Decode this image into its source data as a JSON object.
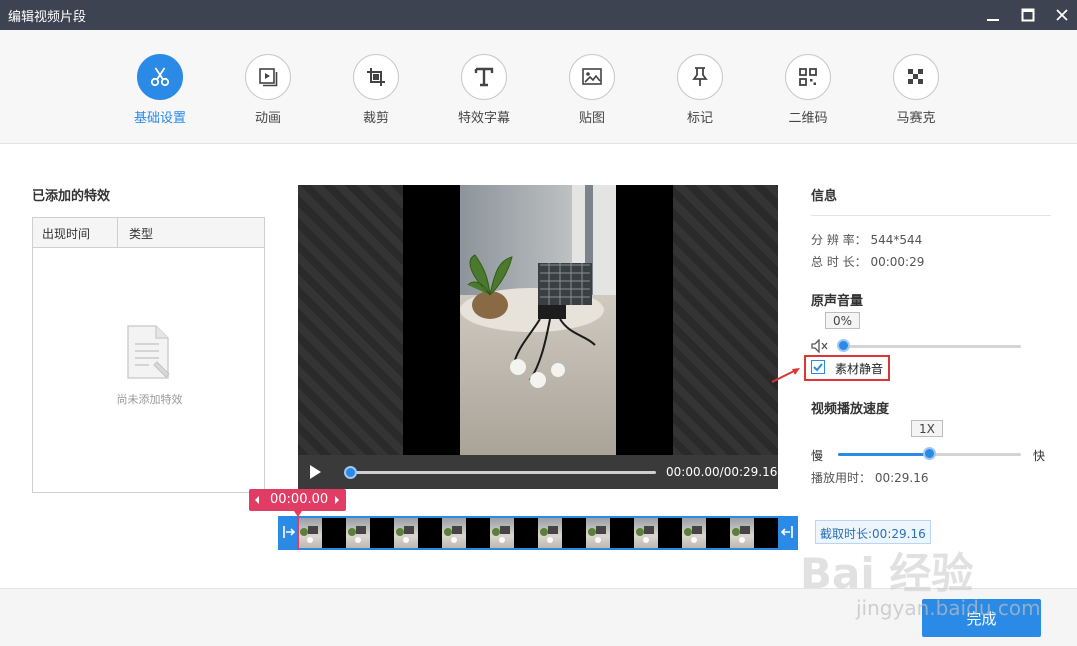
{
  "window": {
    "title": "编辑视频片段"
  },
  "toolbar": {
    "items": [
      {
        "label": "基础设置",
        "icon": "scissors-icon",
        "active": true
      },
      {
        "label": "动画",
        "icon": "play-frame-icon",
        "active": false
      },
      {
        "label": "裁剪",
        "icon": "crop-icon",
        "active": false
      },
      {
        "label": "特效字幕",
        "icon": "text-t-icon",
        "active": false
      },
      {
        "label": "贴图",
        "icon": "image-icon",
        "active": false
      },
      {
        "label": "标记",
        "icon": "pin-icon",
        "active": false
      },
      {
        "label": "二维码",
        "icon": "qrcode-icon",
        "active": false
      },
      {
        "label": "马赛克",
        "icon": "mosaic-icon",
        "active": false
      }
    ]
  },
  "effects_panel": {
    "title": "已添加的特效",
    "columns": [
      "出现时间",
      "类型"
    ],
    "empty_text": "尚未添加特效"
  },
  "player": {
    "time_display": "00:00.00/00:29.16",
    "progress": 0.0
  },
  "timeline": {
    "marker_time": "00:00.00",
    "cut_length": "截取时长:00:29.16"
  },
  "info_panel": {
    "title": "信息",
    "resolution_label": "分 辨 率：",
    "resolution_value": "544*544",
    "duration_label": "总 时 长：",
    "duration_value": "00:00:29",
    "volume": {
      "title": "原声音量",
      "value_text": "0%",
      "value": 0
    },
    "mute": {
      "label": "素材静音",
      "checked": true
    },
    "speed": {
      "title": "视频播放速度",
      "value_text": "1X",
      "slow_label": "慢",
      "fast_label": "快",
      "play_time_label": "播放用时：",
      "play_time_value": "00:29.16",
      "position": 0.5
    }
  },
  "footer": {
    "done_label": "完成"
  },
  "watermark": {
    "brand": "Bai 经验",
    "url": "jingyan.baidu.com"
  },
  "colors": {
    "accent": "#2a8ae6",
    "marker": "#e03c64",
    "highlight": "#e03333",
    "titlebar": "#3d4350"
  }
}
